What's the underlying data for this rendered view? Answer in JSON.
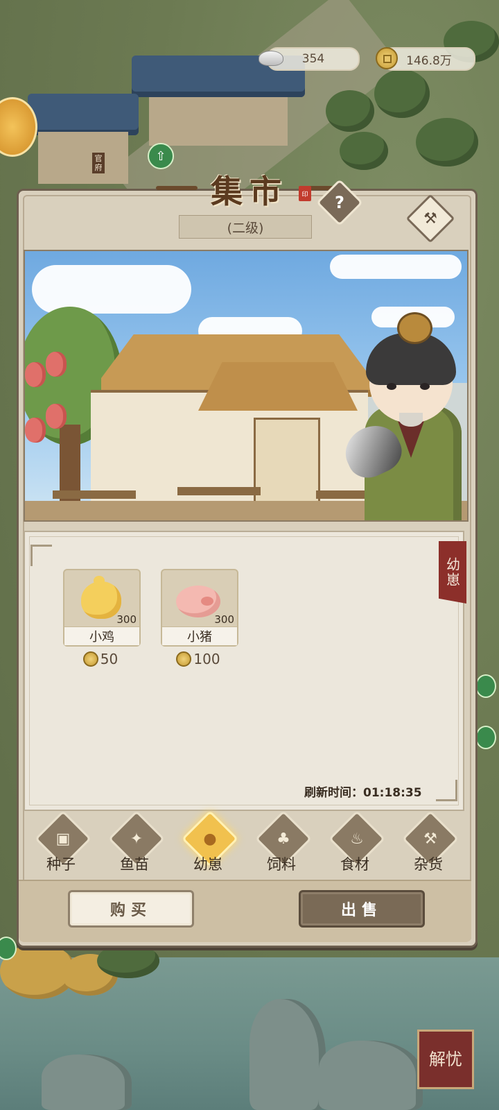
{
  "resources": {
    "silver": {
      "value": "354",
      "icon": "silver-ingot-icon"
    },
    "coins": {
      "value": "146.8万",
      "icon": "copper-coin-icon"
    }
  },
  "world": {
    "building_sign": "官府"
  },
  "panel": {
    "title": "集市",
    "level": "(二级)",
    "help_label": "?",
    "category_tag": "幼崽"
  },
  "shop": {
    "items": [
      {
        "name": "小鸡",
        "qty": "300",
        "price": "50",
        "icon": "chick-icon"
      },
      {
        "name": "小猪",
        "qty": "300",
        "price": "100",
        "icon": "piglet-icon"
      }
    ],
    "refresh_label": "刷新时间：",
    "refresh_time": "01:18:35"
  },
  "tabs": [
    {
      "label": "种子",
      "icon": "seed-bag-icon",
      "active": false
    },
    {
      "label": "鱼苗",
      "icon": "fish-icon",
      "active": false
    },
    {
      "label": "幼崽",
      "icon": "piglet-face-icon",
      "active": true
    },
    {
      "label": "饲料",
      "icon": "feed-sack-icon",
      "active": false
    },
    {
      "label": "食材",
      "icon": "teapot-icon",
      "active": false
    },
    {
      "label": "杂货",
      "icon": "hammer-icon",
      "active": false
    }
  ],
  "actions": {
    "buy_label": "购买",
    "sell_label": "出售"
  },
  "corner_button": {
    "label": "解忧"
  },
  "colors": {
    "panel_bg": "#d9d0bd",
    "active_tab": "#f1c14e",
    "sell_button": "#7a6a56",
    "seal_red": "#8c2f2a"
  }
}
